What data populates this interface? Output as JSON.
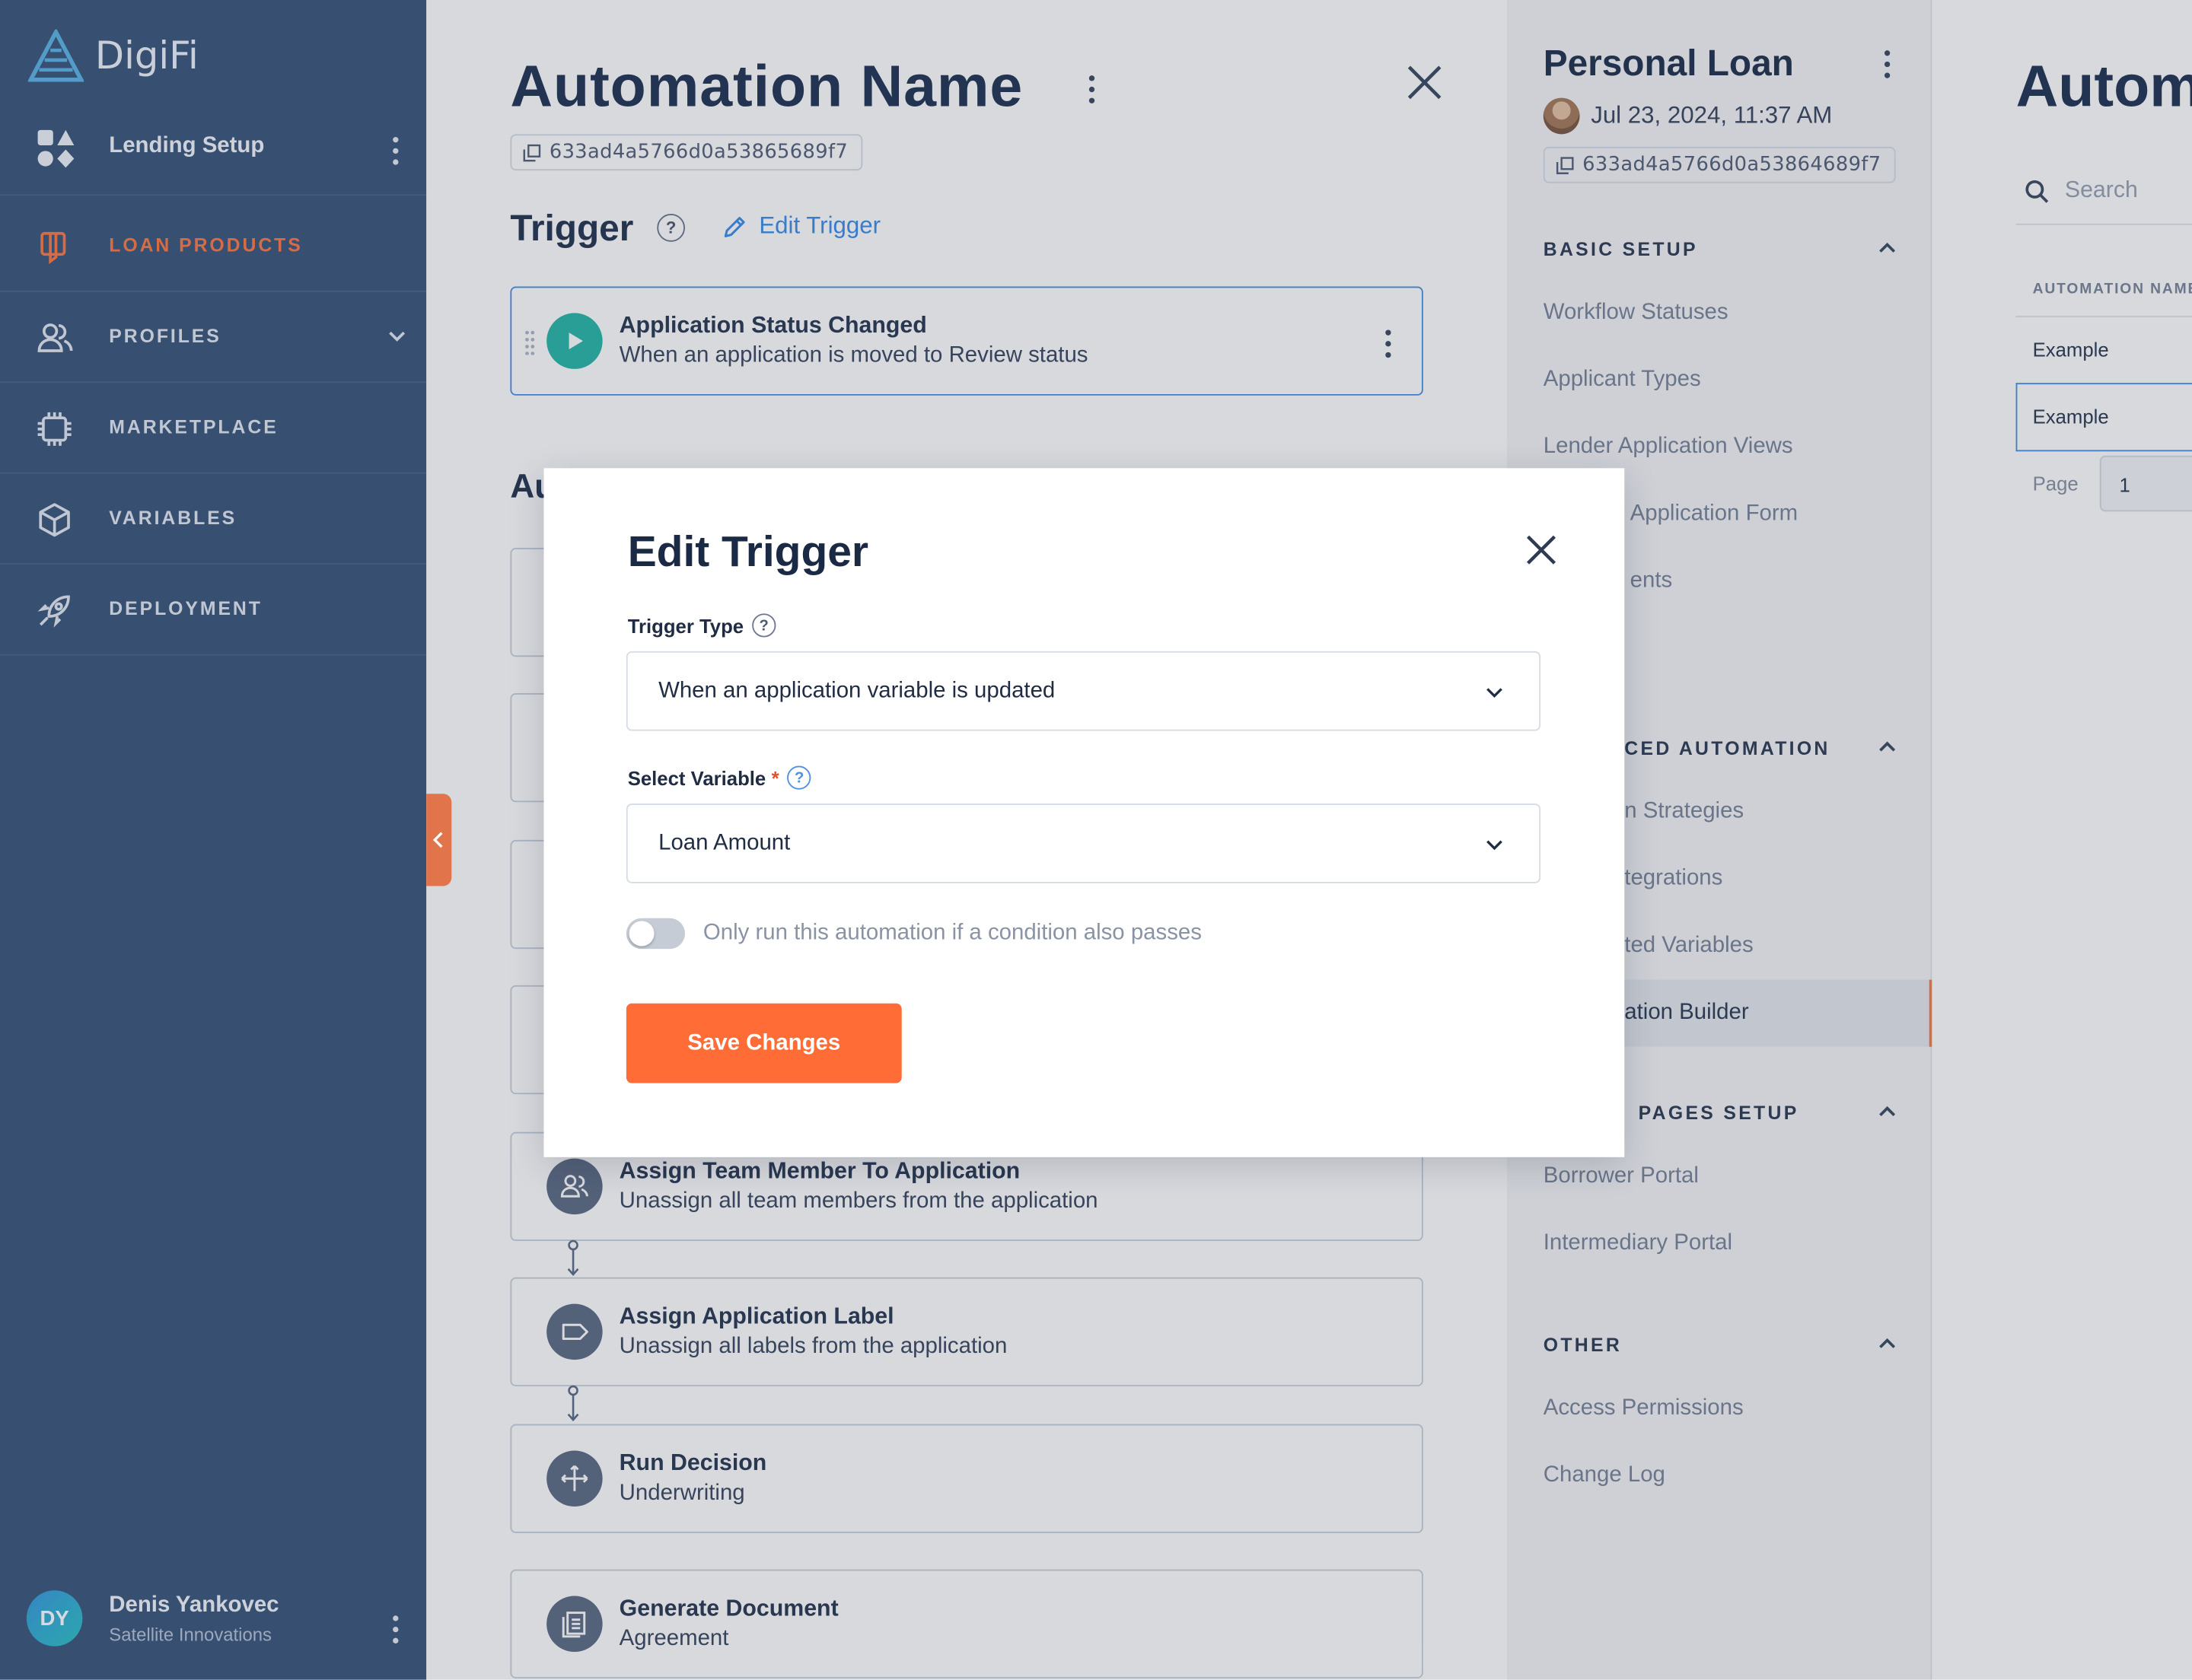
{
  "sidebar": {
    "brand": "DigiFi",
    "workspace": "Lending Setup",
    "nav": [
      {
        "label": "LOAN PRODUCTS",
        "icon": "loan-products-icon",
        "active": true
      },
      {
        "label": "PROFILES",
        "icon": "profiles-icon",
        "active": false,
        "expandable": true
      },
      {
        "label": "MARKETPLACE",
        "icon": "marketplace-icon",
        "active": false
      },
      {
        "label": "VARIABLES",
        "icon": "variables-icon",
        "active": false
      },
      {
        "label": "DEPLOYMENT",
        "icon": "deployment-icon",
        "active": false
      }
    ],
    "user": {
      "initials": "DY",
      "name": "Denis Yankovec",
      "org": "Satellite Innovations"
    }
  },
  "main": {
    "title": "Automation Name",
    "id": "633ad4a5766d0a53865689f7",
    "trigger_heading": "Trigger",
    "edit_trigger": "Edit Trigger",
    "trigger_card": {
      "title": "Application Status Changed",
      "subtitle": "When an application is moved to Review status"
    },
    "actions_heading_partial": "Au",
    "actions": [
      {
        "title": "Assign Team Member To Application",
        "subtitle": "Unassign all team members from the application",
        "icon": "team-icon"
      },
      {
        "title": "Assign Application Label",
        "subtitle": "Unassign all labels from the application",
        "icon": "label-icon"
      },
      {
        "title": "Run Decision",
        "subtitle": "Underwriting",
        "icon": "decision-icon"
      },
      {
        "title": "Generate Document",
        "subtitle": "Agreement",
        "icon": "document-icon"
      }
    ]
  },
  "panel": {
    "title": "Personal Loan",
    "date": "Jul 23, 2024, 11:37 AM",
    "id": "633ad4a5766d0a53864689f7",
    "sections": [
      {
        "heading": "BASIC SETUP",
        "items": [
          "Workflow Statuses",
          "Applicant Types",
          "Lender Application Views",
          "Application Form",
          "ents"
        ]
      },
      {
        "heading": "CED AUTOMATION",
        "items": [
          "n Strategies",
          "tegrations",
          "ted Variables",
          "ation Builder"
        ]
      },
      {
        "heading": "PAGES SETUP",
        "items": [
          "Borrower Portal",
          "Intermediary Portal"
        ]
      },
      {
        "heading": "OTHER",
        "items": [
          "Access Permissions",
          "Change Log"
        ]
      }
    ]
  },
  "farright": {
    "title": "Autom",
    "search_placeholder": "Search",
    "column": "AUTOMATION NAME",
    "rows": [
      "Example",
      "Example"
    ],
    "page_label": "Page",
    "page_value": "1"
  },
  "modal": {
    "title": "Edit Trigger",
    "trigger_type_label": "Trigger Type",
    "trigger_type_value": "When an application variable is updated",
    "variable_label": "Select Variable",
    "required_mark": "*",
    "variable_value": "Loan Amount",
    "toggle_label": "Only run this automation if a condition also passes",
    "toggle_on": false,
    "save_label": "Save Changes"
  },
  "colors": {
    "sidebar": "#3c577c",
    "accent": "#ff6c35",
    "link": "#3e8ee8",
    "trigger_icon": "#2ab7a9"
  }
}
